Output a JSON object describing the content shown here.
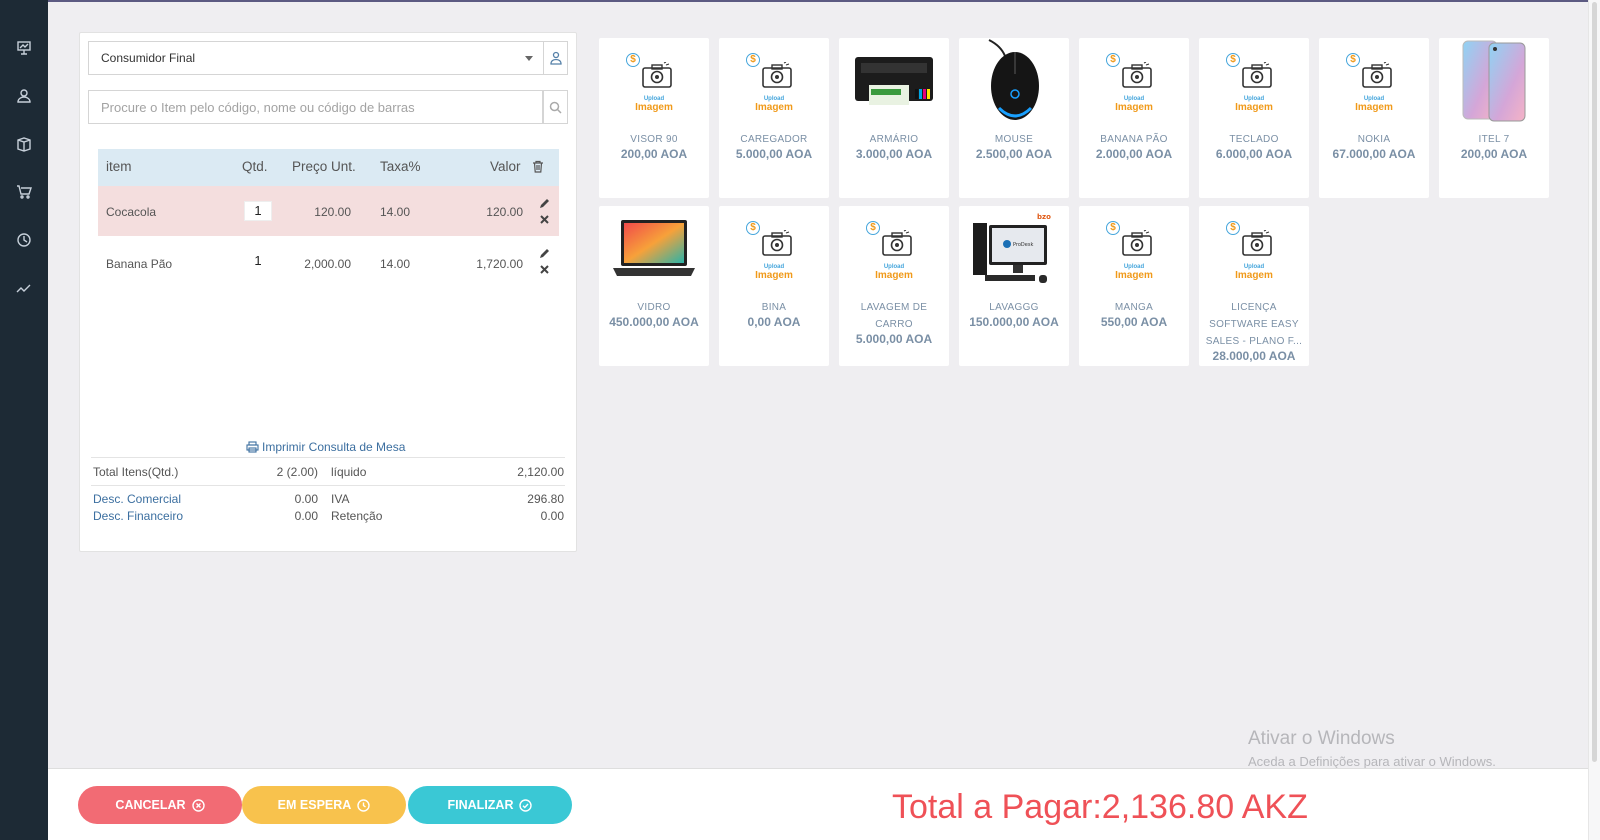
{
  "colors": {
    "sidebar": "#1d2a35",
    "cancel": "#f26b74",
    "hold": "#f8c24d",
    "finish": "#3ac8d5",
    "total": "#ef5157",
    "link": "#3c6fa0"
  },
  "sidebar": {
    "icons": [
      "presentation-icon",
      "users-icon",
      "box-icon",
      "cart-icon",
      "history-icon",
      "trend-icon"
    ]
  },
  "customer": {
    "selected": "Consumidor Final"
  },
  "search": {
    "placeholder": "Procure o Item pelo código, nome ou código de barras"
  },
  "table": {
    "headers": {
      "item": "item",
      "qty": "Qtd.",
      "price": "Preço Unt.",
      "tax": "Taxa%",
      "value": "Valor"
    },
    "rows": [
      {
        "item": "Cocacola",
        "qty": "1",
        "price": "120.00",
        "tax": "14.00",
        "value": "120.00"
      },
      {
        "item": "Banana Pão",
        "qty": "1",
        "price": "2,000.00",
        "tax": "14.00",
        "value": "1,720.00"
      }
    ]
  },
  "print_link": "Imprimir Consulta de Mesa",
  "summary": {
    "total_items_label": "Total Itens(Qtd.)",
    "total_items_value": "2 (2.00)",
    "liquido_label": "líquido",
    "liquido_value": "2,120.00",
    "desc_comercial_label": "Desc. Comercial",
    "desc_comercial_value": "0.00",
    "iva_label": "IVA",
    "iva_value": "296.80",
    "desc_financeiro_label": "Desc. Financeiro",
    "desc_financeiro_value": "0.00",
    "retencao_label": "Retenção",
    "retencao_value": "0.00"
  },
  "placeholder_image": {
    "line1": "Upload",
    "line2": "Imagem",
    "coin": "$"
  },
  "products": [
    {
      "name": "VISOR 90",
      "price": "200,00 AOA",
      "image": "upload-placeholder"
    },
    {
      "name": "CAREGADOR",
      "price": "5.000,00 AOA",
      "image": "upload-placeholder"
    },
    {
      "name": "ARMÁRIO",
      "price": "3.000,00 AOA",
      "image": "printer"
    },
    {
      "name": "MOUSE",
      "price": "2.500,00 AOA",
      "image": "mouse"
    },
    {
      "name": "BANANA PÃO",
      "price": "2.000,00 AOA",
      "image": "upload-placeholder"
    },
    {
      "name": "TECLADO",
      "price": "6.000,00 AOA",
      "image": "upload-placeholder"
    },
    {
      "name": "NOKIA",
      "price": "67.000,00 AOA",
      "image": "upload-placeholder"
    },
    {
      "name": "ITEL 7",
      "price": "200,00 AOA",
      "image": "phone"
    },
    {
      "name": "VIDRO",
      "price": "450.000,00 AOA",
      "image": "laptop"
    },
    {
      "name": "BINA",
      "price": "0,00 AOA",
      "image": "upload-placeholder"
    },
    {
      "name": "LAVAGEM DE CARRO",
      "price": "5.000,00 AOA",
      "image": "upload-placeholder"
    },
    {
      "name": "LAVAGGG",
      "price": "150.000,00 AOA",
      "image": "desktop"
    },
    {
      "name": "MANGA",
      "price": "550,00 AOA",
      "image": "upload-placeholder"
    },
    {
      "name": "LICENÇA SOFTWARE EASY SALES - PLANO F...",
      "price": "28.000,00 AOA",
      "image": "upload-placeholder"
    }
  ],
  "desktop_brand_tag": "bzo",
  "watermark": {
    "line1": "Ativar o Windows",
    "line2": "Aceda a Definições para ativar o Windows."
  },
  "buttons": {
    "cancel": "CANCELAR",
    "hold": "EM ESPERA",
    "finish": "FINALIZAR"
  },
  "total": {
    "label": "Total a Pagar:",
    "value": "2,136.80 AKZ"
  }
}
